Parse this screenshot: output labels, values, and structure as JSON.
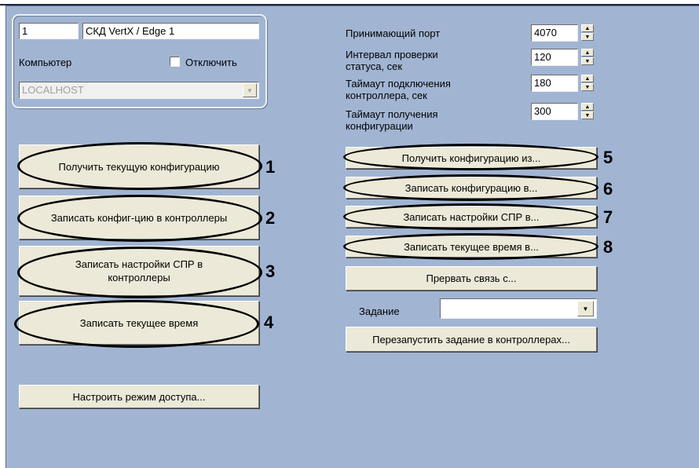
{
  "settings": {
    "id_value": "1",
    "name_value": "СКД VertX / Edge 1",
    "computer_label": "Компьютер",
    "disable_label": "Отключить",
    "computer_value": "LOCALHOST"
  },
  "params": {
    "port_label": "Принимающий порт",
    "port_value": "4070",
    "status_label": "Интервал проверки статуса, сек",
    "status_value": "120",
    "conn_label": "Таймаут подключения контроллера, сек",
    "conn_value": "180",
    "config_label": "Таймаут получения конфигурации",
    "config_value": "300"
  },
  "left_buttons": {
    "b1": "Получить текущую конфигурацию",
    "b2": "Записать конфиг-цию в контроллеры",
    "b3": "Записать настройки СПР в контроллеры",
    "b4": "Записать текущее время",
    "b5": "Настроить режим доступа..."
  },
  "right_buttons": {
    "b1": "Получить конфигурацию из...",
    "b2": "Записать конфигурацию в...",
    "b3": "Записать настройки СПР в...",
    "b4": "Записать текущее время в...",
    "b5": "Прервать связь с..."
  },
  "task": {
    "label": "Задание",
    "value": "",
    "restart_button": "Перезапустить задание в контроллерах..."
  },
  "callouts": [
    "1",
    "2",
    "3",
    "4",
    "5",
    "6",
    "7",
    "8"
  ]
}
